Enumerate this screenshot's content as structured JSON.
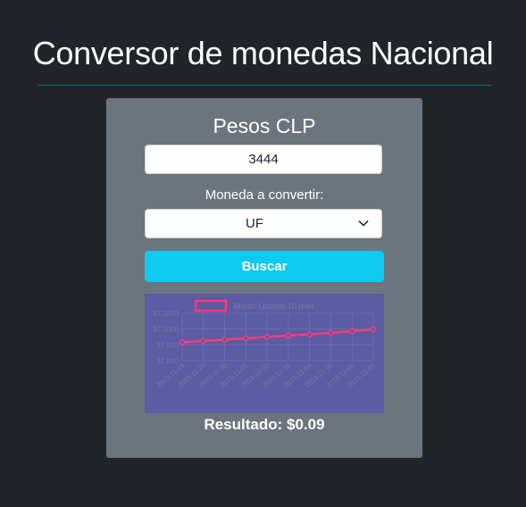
{
  "header": {
    "title": "Conversor de monedas Nacional"
  },
  "converter": {
    "heading": "Pesos CLP",
    "amount_value": "3444",
    "currency_label": "Moneda a convertir:",
    "currency_selected": "UF",
    "search_label": "Buscar",
    "result_text": "Resultado: $0.09"
  },
  "colors": {
    "background": "#212529",
    "card": "#6c757d",
    "button": "#0dcaf0",
    "chart_background": "#5c5ba3",
    "series_line": "#ff3a7a",
    "title_rule": "#0d6d7c"
  },
  "icons": {
    "select_arrow": "chevron-down-icon"
  },
  "chart_data": {
    "type": "line",
    "legend": [
      "Monto Últimos 10 días"
    ],
    "legend_position": "top-center",
    "grid": true,
    "y_ticks": [
      "37.800",
      "37.900",
      "37.1000",
      "37.1800"
    ],
    "x": [
      "2023-11-28",
      "2023-11-29",
      "2023-11-30",
      "2023-12-01",
      "2023-12-02",
      "2023-12-03",
      "2023-12-04",
      "2023-12-05",
      "2023-12-06",
      "2023-12-07"
    ],
    "series": [
      {
        "name": "Monto Últimos 10 días",
        "values": [
          36.94,
          36.98,
          37.02,
          37.06,
          37.1,
          37.14,
          37.18,
          37.22,
          37.27,
          37.32
        ]
      }
    ],
    "ylim": [
      36.4,
      37.8
    ]
  }
}
